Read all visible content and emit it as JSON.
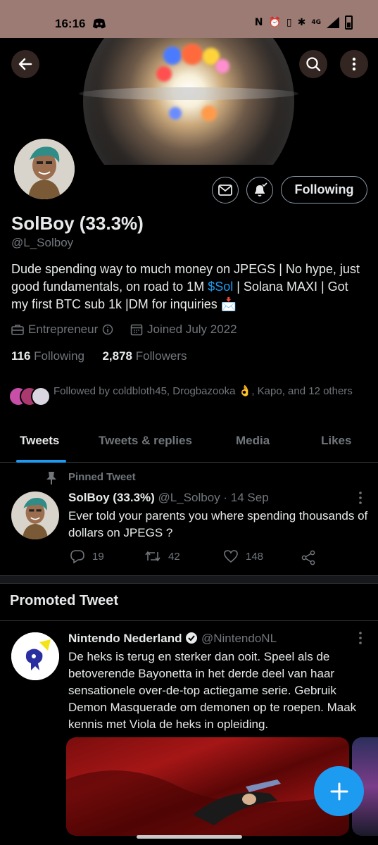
{
  "status_bar": {
    "time": "16:16",
    "network": "4G"
  },
  "profile": {
    "display_name": "SolBoy (33.3%)",
    "handle": "@L_Solboy",
    "bio_part1": "Dude spending way to much money on JPEGS | No hype, just good fundamentals, on road to 1M ",
    "bio_link": "$Sol",
    "bio_part2": " | Solana MAXI | Got my first BTC sub 1k |DM for inquiries 📩",
    "profession": "Entrepreneur",
    "joined": "Joined July 2022",
    "following_count": "116",
    "following_label": "Following",
    "followers_count": "2,878",
    "followers_label": "Followers",
    "followed_by": "Followed by coldbloth45, Drogbazooka 👌, Kapo, and 12 others",
    "follow_button": "Following"
  },
  "tabs": [
    "Tweets",
    "Tweets & replies",
    "Media",
    "Likes"
  ],
  "pinned_tweet": {
    "label": "Pinned Tweet",
    "name": "SolBoy (33.3%)",
    "handle_date": "@L_Solboy · 14 Sep",
    "text": "Ever told your parents you where spending thousands of dollars on JPEGS ?",
    "replies": "19",
    "retweets": "42",
    "likes": "148"
  },
  "promoted": {
    "section_title": "Promoted Tweet",
    "name": "Nintendo Nederland",
    "handle": "@NintendoNL",
    "text": "De heks is terug en sterker dan ooit. Speel als de betoverende Bayonetta in het derde deel van haar sensationele over-de-top actiegame serie. Gebruik Demon Masquerade  om demonen op te roepen. Maak kennis met Viola de heks in opleiding."
  },
  "colors": {
    "accent": "#1d9bf0",
    "muted": "#71767b",
    "text": "#e7e9ea",
    "status_bar": "#9b7b73"
  },
  "icons": [
    "back-arrow-icon",
    "search-icon",
    "more-vertical-icon",
    "mail-icon",
    "bell-icon",
    "briefcase-icon",
    "info-icon",
    "calendar-icon",
    "pin-icon",
    "reply-icon",
    "retweet-icon",
    "like-icon",
    "share-icon",
    "verified-icon",
    "compose-plus-icon"
  ]
}
